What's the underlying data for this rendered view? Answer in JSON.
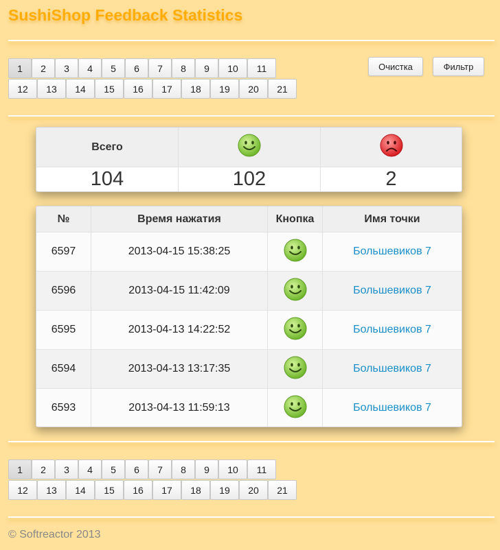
{
  "header": {
    "title": "SushiShop Feedback Statistics"
  },
  "toolbar": {
    "clear_label": "Очистка",
    "filter_label": "Фильтр"
  },
  "pagination": {
    "active_page": "1",
    "rows": [
      [
        "1",
        "2",
        "3",
        "4",
        "5",
        "6",
        "7",
        "8",
        "9",
        "10",
        "11"
      ],
      [
        "12",
        "13",
        "14",
        "15",
        "16",
        "17",
        "18",
        "19",
        "20",
        "21"
      ]
    ]
  },
  "summary": {
    "total_label": "Всего",
    "positive_icon": "smiley-happy-icon",
    "negative_icon": "smiley-sad-icon",
    "total": "104",
    "positive": "102",
    "negative": "2"
  },
  "feedback_table": {
    "headers": {
      "id": "№",
      "time": "Время нажатия",
      "button": "Кнопка",
      "point": "Имя точки"
    },
    "rows": [
      {
        "id": "6597",
        "time": "2013-04-15 15:38:25",
        "button": "smiley-happy-icon",
        "point": "Большевиков 7"
      },
      {
        "id": "6596",
        "time": "2013-04-15 11:42:09",
        "button": "smiley-happy-icon",
        "point": "Большевиков 7"
      },
      {
        "id": "6595",
        "time": "2013-04-13 14:22:52",
        "button": "smiley-happy-icon",
        "point": "Большевиков 7"
      },
      {
        "id": "6594",
        "time": "2013-04-13 13:17:35",
        "button": "smiley-happy-icon",
        "point": "Большевиков 7"
      },
      {
        "id": "6593",
        "time": "2013-04-13 11:59:13",
        "button": "smiley-happy-icon",
        "point": "Большевиков 7"
      }
    ]
  },
  "footer": {
    "copyright": "© Softreactor 2013"
  },
  "colors": {
    "background": "#ffe19b",
    "title": "#ffad05",
    "link": "#1a8fc9",
    "positive": "#7cc43a",
    "negative": "#e8252a"
  }
}
